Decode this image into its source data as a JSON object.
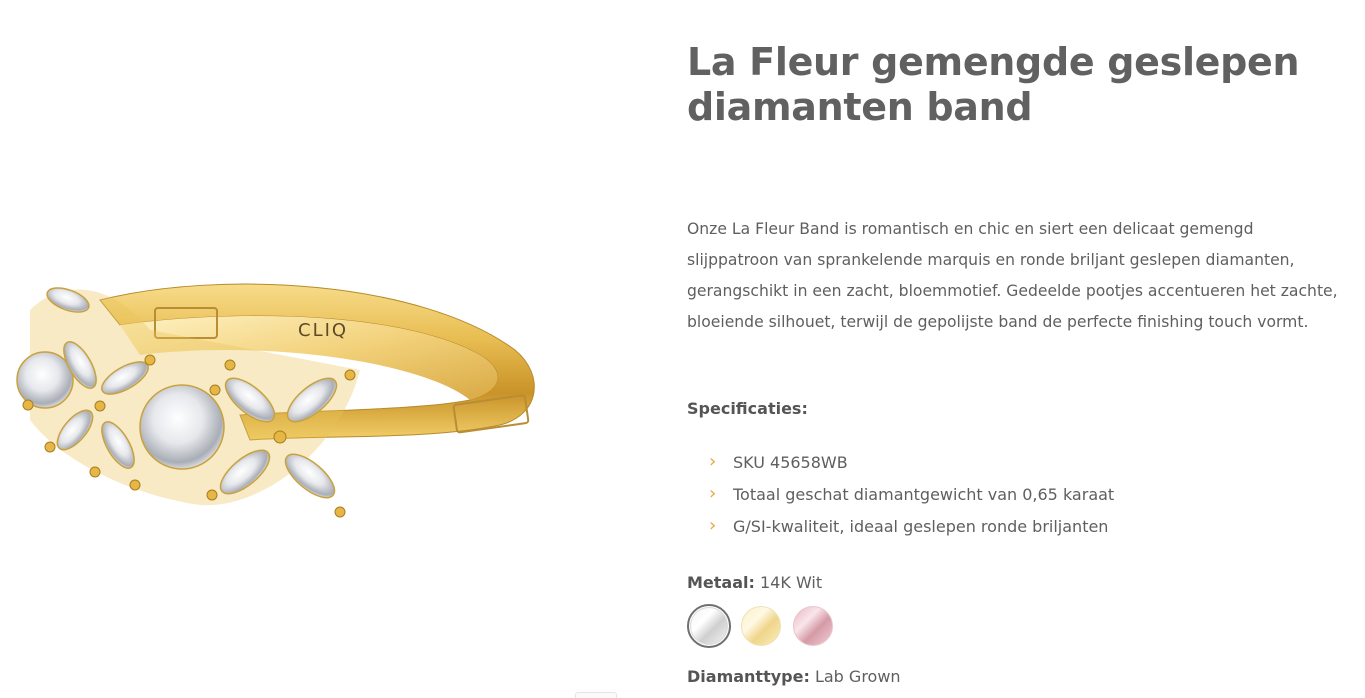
{
  "product": {
    "title": "La Fleur gemengde geslepen diamanten band",
    "image_engraving": "CLIQ",
    "description": "Onze La Fleur Band is romantisch en chic en siert een delicaat gemengd slijppatroon van sprankelende marquis en ronde briljant geslepen diamanten, gerangschikt in een zacht, bloemmotief. Gedeelde pootjes accentueren het zachte, bloeiende silhouet, terwijl de gepolijste band de perfecte finishing touch vormt."
  },
  "specs": {
    "heading": "Specificaties:",
    "items": [
      {
        "icon": "chevron-right-icon",
        "text": "SKU 45658WB"
      },
      {
        "icon": "chevron-right-icon",
        "text": "Totaal geschat diamantgewicht van 0,65 karaat"
      },
      {
        "icon": "chevron-right-icon",
        "text": "G/SI-kwaliteit, ideaal geslepen ronde briljanten"
      }
    ],
    "bullet_color": "#e9a33a"
  },
  "metal": {
    "label": "Metaal:",
    "value": "14K Wit",
    "options": [
      {
        "name": "white-gold",
        "selected": true
      },
      {
        "name": "yellow-gold",
        "selected": false
      },
      {
        "name": "rose-gold",
        "selected": false
      }
    ]
  },
  "diamond": {
    "label": "Diamanttype:",
    "value": "Lab Grown"
  },
  "colors": {
    "text": "#5f5f5f",
    "title": "#616161",
    "accent": "#e9a33a",
    "gold": "#e2b64a"
  }
}
